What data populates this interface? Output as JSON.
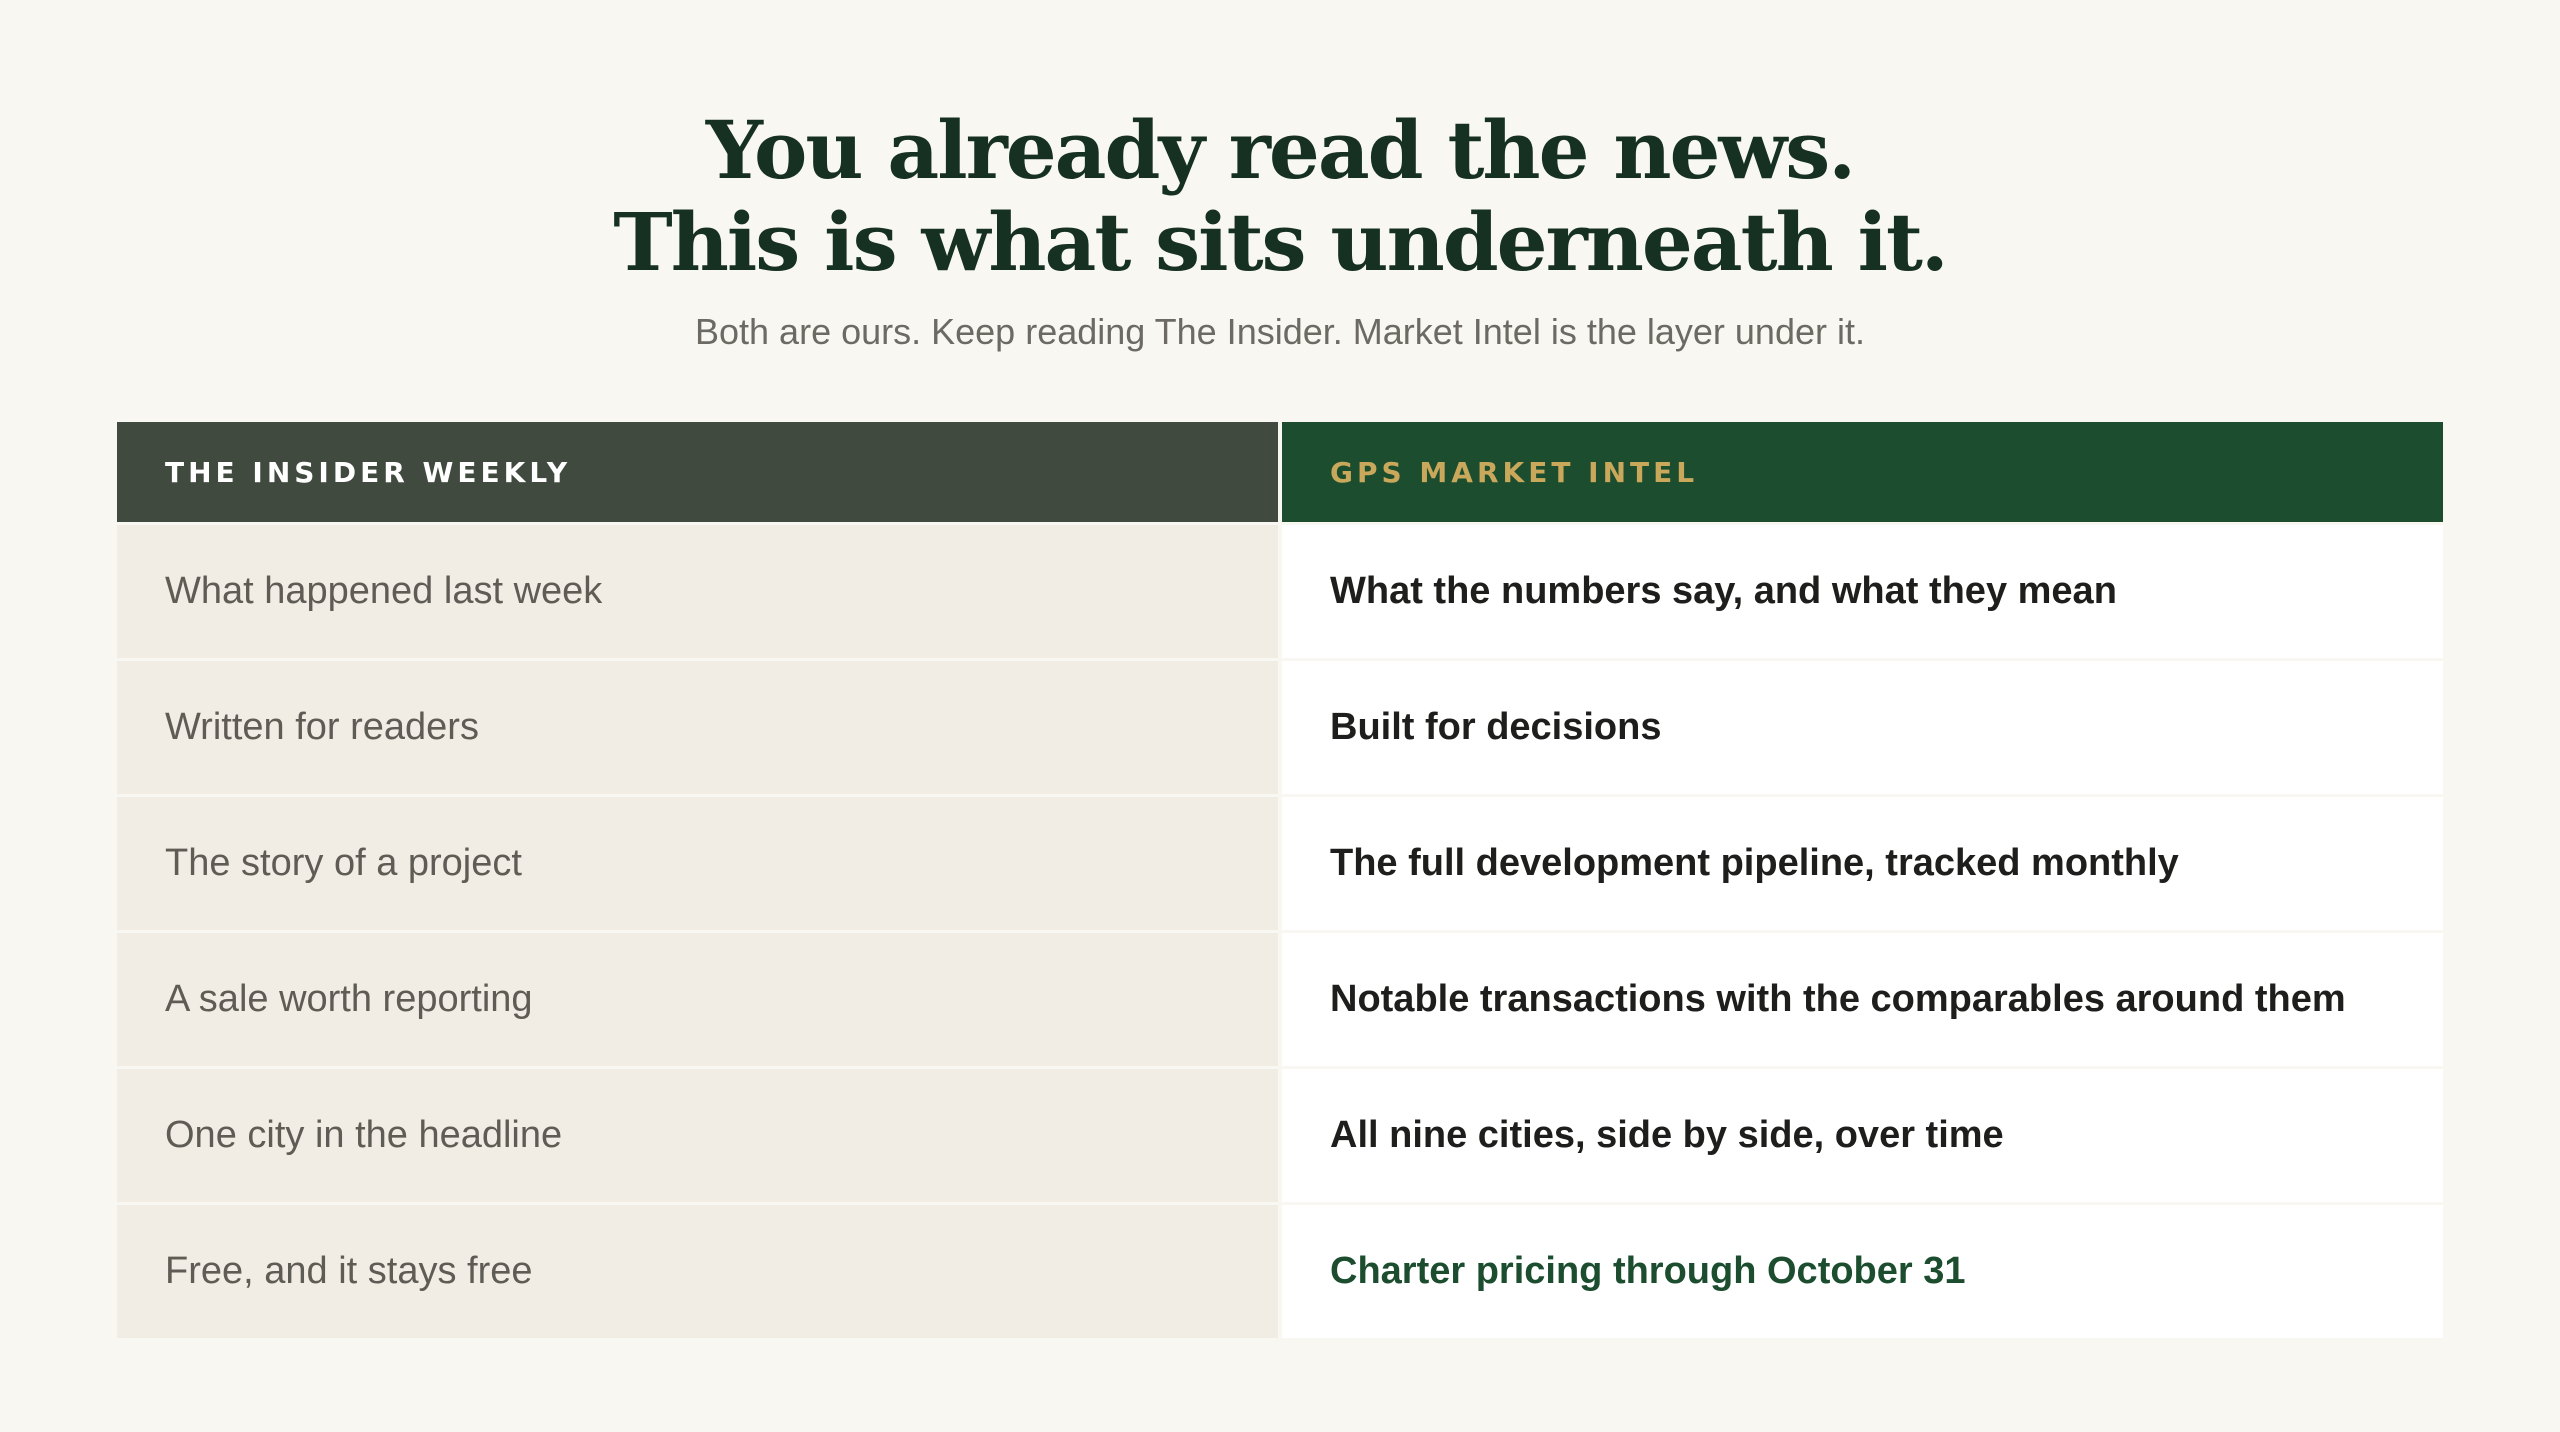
{
  "hero": {
    "headline_line1": "You already read the news.",
    "headline_line2": "This is what sits underneath it.",
    "subtitle": "Both are ours. Keep reading The Insider. Market Intel is the layer under it."
  },
  "comparison": {
    "columns": {
      "left": "THE INSIDER WEEKLY",
      "right": "GPS MARKET INTEL"
    },
    "rows": [
      {
        "left": "What happened last week",
        "right": "What the numbers say, and what they mean"
      },
      {
        "left": "Written for readers",
        "right": "Built for decisions"
      },
      {
        "left": "The story of a project",
        "right": "The full development pipeline, tracked monthly"
      },
      {
        "left": "A sale worth reporting",
        "right": "Notable transactions with the comparables around them"
      },
      {
        "left": "One city in the headline",
        "right": "All nine cities, side by side, over time"
      },
      {
        "left": "Free, and it stays free",
        "right": "Charter pricing through October 31"
      }
    ]
  },
  "colors": {
    "background": "#f9f7f2",
    "headline": "#163122",
    "left_header_bg": "#404a3f",
    "right_header_bg": "#1b4d2e",
    "right_header_text": "#c9a85b",
    "left_cell_bg": "#f1ede5",
    "accent_text": "#1b4d2e"
  }
}
